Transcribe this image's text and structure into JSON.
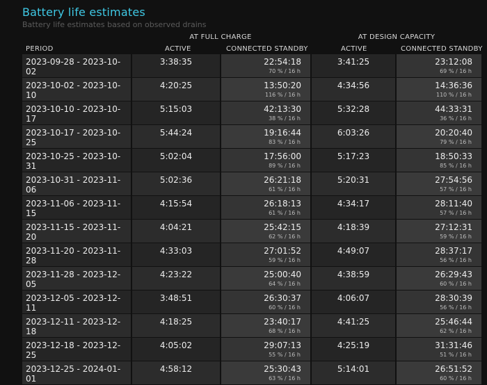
{
  "title": "Battery life estimates",
  "subtitle": "Battery life estimates based on observed drains",
  "groups": {
    "full": "AT FULL CHARGE",
    "design": "AT DESIGN CAPACITY"
  },
  "columns": {
    "period": "PERIOD",
    "full_active": "ACTIVE",
    "full_standby": "CONNECTED STANDBY",
    "design_active": "ACTIVE",
    "design_standby": "CONNECTED STANDBY"
  },
  "rows": [
    {
      "period": "2023-09-28 - 2023-10-02",
      "full_active": "3:38:35",
      "full_standby": "22:54:18",
      "full_standby_detail": "70 % / 16 h",
      "design_active": "3:41:25",
      "design_standby": "23:12:08",
      "design_standby_detail": "69 % / 16 h"
    },
    {
      "period": "2023-10-02 - 2023-10-10",
      "full_active": "4:20:25",
      "full_standby": "13:50:20",
      "full_standby_detail": "116 % / 16 h",
      "design_active": "4:34:56",
      "design_standby": "14:36:36",
      "design_standby_detail": "110 % / 16 h"
    },
    {
      "period": "2023-10-10 - 2023-10-17",
      "full_active": "5:15:03",
      "full_standby": "42:13:30",
      "full_standby_detail": "38 % / 16 h",
      "design_active": "5:32:28",
      "design_standby": "44:33:31",
      "design_standby_detail": "36 % / 16 h"
    },
    {
      "period": "2023-10-17 - 2023-10-25",
      "full_active": "5:44:24",
      "full_standby": "19:16:44",
      "full_standby_detail": "83 % / 16 h",
      "design_active": "6:03:26",
      "design_standby": "20:20:40",
      "design_standby_detail": "79 % / 16 h"
    },
    {
      "period": "2023-10-25 - 2023-10-31",
      "full_active": "5:02:04",
      "full_standby": "17:56:00",
      "full_standby_detail": "89 % / 16 h",
      "design_active": "5:17:23",
      "design_standby": "18:50:33",
      "design_standby_detail": "85 % / 16 h"
    },
    {
      "period": "2023-10-31 - 2023-11-06",
      "full_active": "5:02:36",
      "full_standby": "26:21:18",
      "full_standby_detail": "61 % / 16 h",
      "design_active": "5:20:31",
      "design_standby": "27:54:56",
      "design_standby_detail": "57 % / 16 h"
    },
    {
      "period": "2023-11-06 - 2023-11-15",
      "full_active": "4:15:54",
      "full_standby": "26:18:13",
      "full_standby_detail": "61 % / 16 h",
      "design_active": "4:34:17",
      "design_standby": "28:11:40",
      "design_standby_detail": "57 % / 16 h"
    },
    {
      "period": "2023-11-15 - 2023-11-20",
      "full_active": "4:04:21",
      "full_standby": "25:42:15",
      "full_standby_detail": "62 % / 16 h",
      "design_active": "4:18:39",
      "design_standby": "27:12:31",
      "design_standby_detail": "59 % / 16 h"
    },
    {
      "period": "2023-11-20 - 2023-11-28",
      "full_active": "4:33:03",
      "full_standby": "27:01:52",
      "full_standby_detail": "59 % / 16 h",
      "design_active": "4:49:07",
      "design_standby": "28:37:17",
      "design_standby_detail": "56 % / 16 h"
    },
    {
      "period": "2023-11-28 - 2023-12-05",
      "full_active": "4:23:22",
      "full_standby": "25:00:40",
      "full_standby_detail": "64 % / 16 h",
      "design_active": "4:38:59",
      "design_standby": "26:29:43",
      "design_standby_detail": "60 % / 16 h"
    },
    {
      "period": "2023-12-05 - 2023-12-11",
      "full_active": "3:48:51",
      "full_standby": "26:30:37",
      "full_standby_detail": "60 % / 16 h",
      "design_active": "4:06:07",
      "design_standby": "28:30:39",
      "design_standby_detail": "56 % / 16 h"
    },
    {
      "period": "2023-12-11 - 2023-12-18",
      "full_active": "4:18:25",
      "full_standby": "23:40:17",
      "full_standby_detail": "68 % / 16 h",
      "design_active": "4:41:25",
      "design_standby": "25:46:44",
      "design_standby_detail": "62 % / 16 h"
    },
    {
      "period": "2023-12-18 - 2023-12-25",
      "full_active": "4:05:02",
      "full_standby": "29:07:13",
      "full_standby_detail": "55 % / 16 h",
      "design_active": "4:25:19",
      "design_standby": "31:31:46",
      "design_standby_detail": "51 % / 16 h"
    },
    {
      "period": "2023-12-25 - 2024-01-01",
      "full_active": "4:58:12",
      "full_standby": "25:30:43",
      "full_standby_detail": "63 % / 16 h",
      "design_active": "5:14:01",
      "design_standby": "26:51:52",
      "design_standby_detail": "60 % / 16 h"
    }
  ]
}
